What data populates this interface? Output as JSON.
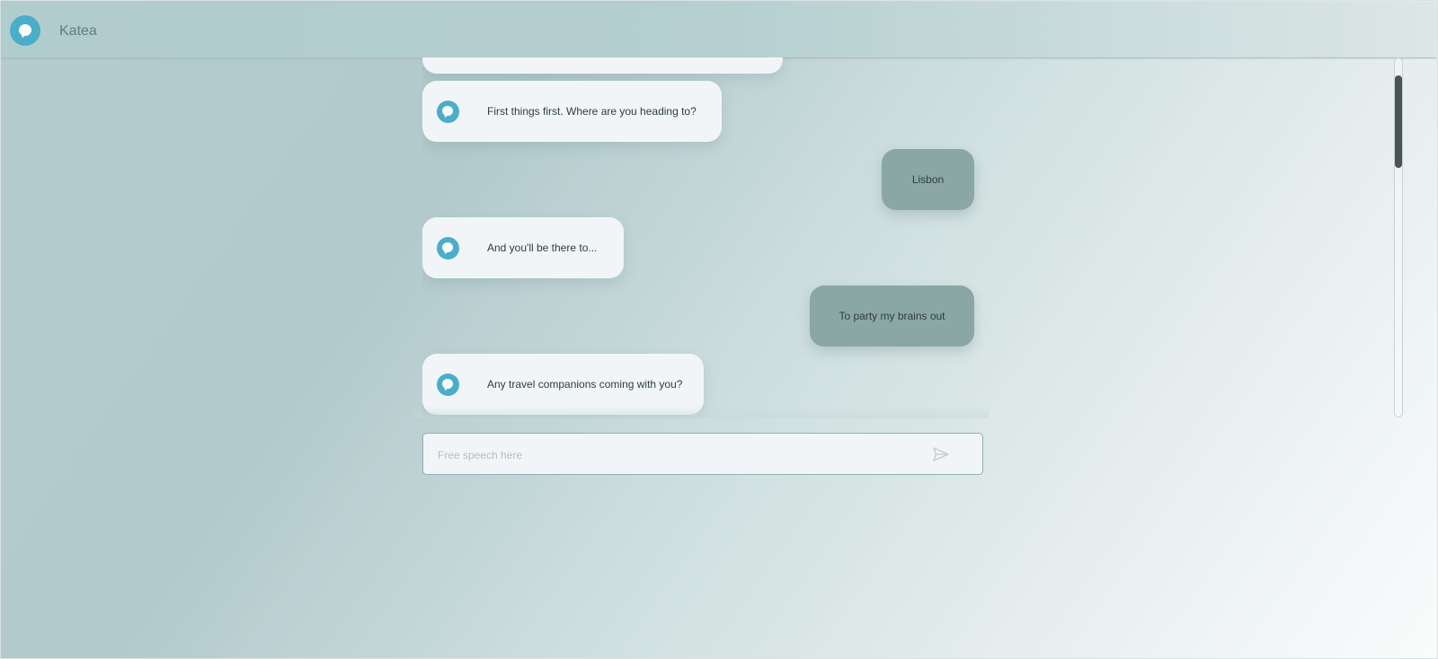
{
  "app": {
    "title": "Katea",
    "logo_icon": "chat-bubble-icon",
    "accent_color": "#4aaec9"
  },
  "chat": {
    "messages": [
      {
        "sender": "bot",
        "text": "",
        "avatar_icon": "chat-bubble-icon"
      },
      {
        "sender": "bot",
        "text": "First things first. Where are you heading to?",
        "avatar_icon": "chat-bubble-icon"
      },
      {
        "sender": "user",
        "text": "Lisbon"
      },
      {
        "sender": "bot",
        "text": "And you'll be there to...",
        "avatar_icon": "chat-bubble-icon"
      },
      {
        "sender": "user",
        "text": "To party my brains out"
      },
      {
        "sender": "bot",
        "text": "Any travel companions coming with you?",
        "avatar_icon": "chat-bubble-icon"
      }
    ],
    "bot_bubble_color": "#f1f5f8",
    "user_bubble_color": "#8aa7a6"
  },
  "composer": {
    "placeholder": "Free speech here",
    "value": "",
    "send_icon": "send-icon"
  }
}
